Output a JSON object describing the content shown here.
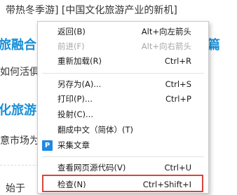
{
  "page": {
    "line1": "带热冬季游] [中国文化旅游产业的新机]",
    "line2": "旅融合",
    "line2b": "篇",
    "line3": "如何活俱",
    "line4": "化旅游",
    "line5": "意市场为",
    "line6": "始于"
  },
  "menu": {
    "items": [
      {
        "label": "返回(B)",
        "shortcut": "Alt+向左箭头"
      },
      {
        "label": "前进(F)",
        "shortcut": "Alt+向右箭头"
      },
      {
        "label": "重新加载(R)",
        "shortcut": "Ctrl+R"
      },
      {
        "label": "另存为(A)...",
        "shortcut": "Ctrl+S"
      },
      {
        "label": "打印(P)...",
        "shortcut": "Ctrl+P"
      },
      {
        "label": "投射(C)...",
        "shortcut": ""
      },
      {
        "label": "翻成中文（简体）(T)",
        "shortcut": ""
      },
      {
        "label": "采集文章",
        "shortcut": "",
        "icon": "P"
      },
      {
        "label": "查看网页源代码(V)",
        "shortcut": "Ctrl+U"
      },
      {
        "label": "检查(N)",
        "shortcut": "Ctrl+Shift+I"
      }
    ]
  },
  "colors": {
    "highlight_border": "#d9443a",
    "accent_text": "#1a8fd6",
    "p_icon_bg": "#1e88e5"
  }
}
